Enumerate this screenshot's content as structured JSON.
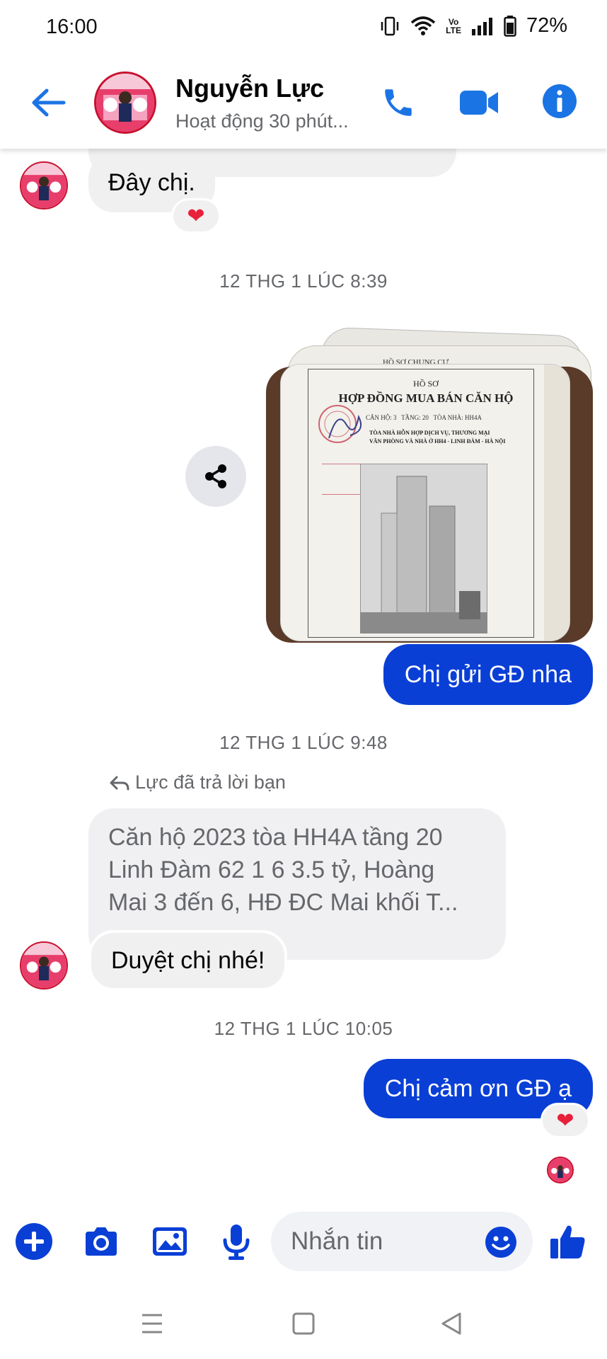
{
  "status_bar": {
    "time": "16:00",
    "volte_top": "Vo",
    "volte_bottom": "LTE",
    "battery": "72%"
  },
  "header": {
    "contact_name": "Nguyễn Lực",
    "activity_status": "Hoạt động 30 phút..."
  },
  "messages": {
    "first_incoming": "Đây chị.",
    "first_reaction": "❤",
    "timestamp_1": "12 THG 1 LÚC 8:39",
    "outgoing_1": "Chị gửi GĐ nha",
    "doc_lines": {
      "ho_so": "HỒ SƠ",
      "title": "HỢP ĐỒNG MUA BÁN CĂN HỘ",
      "can_ho": "CĂN HỘ: 3",
      "tang": "TẦNG: 20",
      "toa_nha": "TÒA NHÀ: HH4A",
      "building_line1": "TÒA NHÀ HỖN HỢP DỊCH VỤ, THƯƠNG MẠI",
      "building_line2": "VĂN PHÒNG VÀ NHÀ Ở HH4 - LINH ĐÀM - HÀ NỘI",
      "back_header": "HỒ SƠ CHUNG CƯ"
    },
    "timestamp_2": "12 THG 1 LÚC 9:48",
    "reply_label": "Lực đã trả lời bạn",
    "quoted_lines": [
      "Căn hộ 2023 tòa HH4A tầng 20",
      "Linh Đàm 62 1 6 3.5 tỷ, Hoàng",
      "Mai 3 đến 6, HĐ ĐC Mai khối T..."
    ],
    "incoming_reply": "Duyệt chị nhé!",
    "timestamp_3": "12 THG 1 LÚC 10:05",
    "outgoing_2": "Chị cảm ơn GĐ ạ",
    "second_reaction": "❤"
  },
  "composer": {
    "placeholder": "Nhắn tin"
  },
  "colors": {
    "accent_blue": "#0a3fd6",
    "icon_blue": "#1b74e4",
    "reaction_red": "#e8203a"
  }
}
